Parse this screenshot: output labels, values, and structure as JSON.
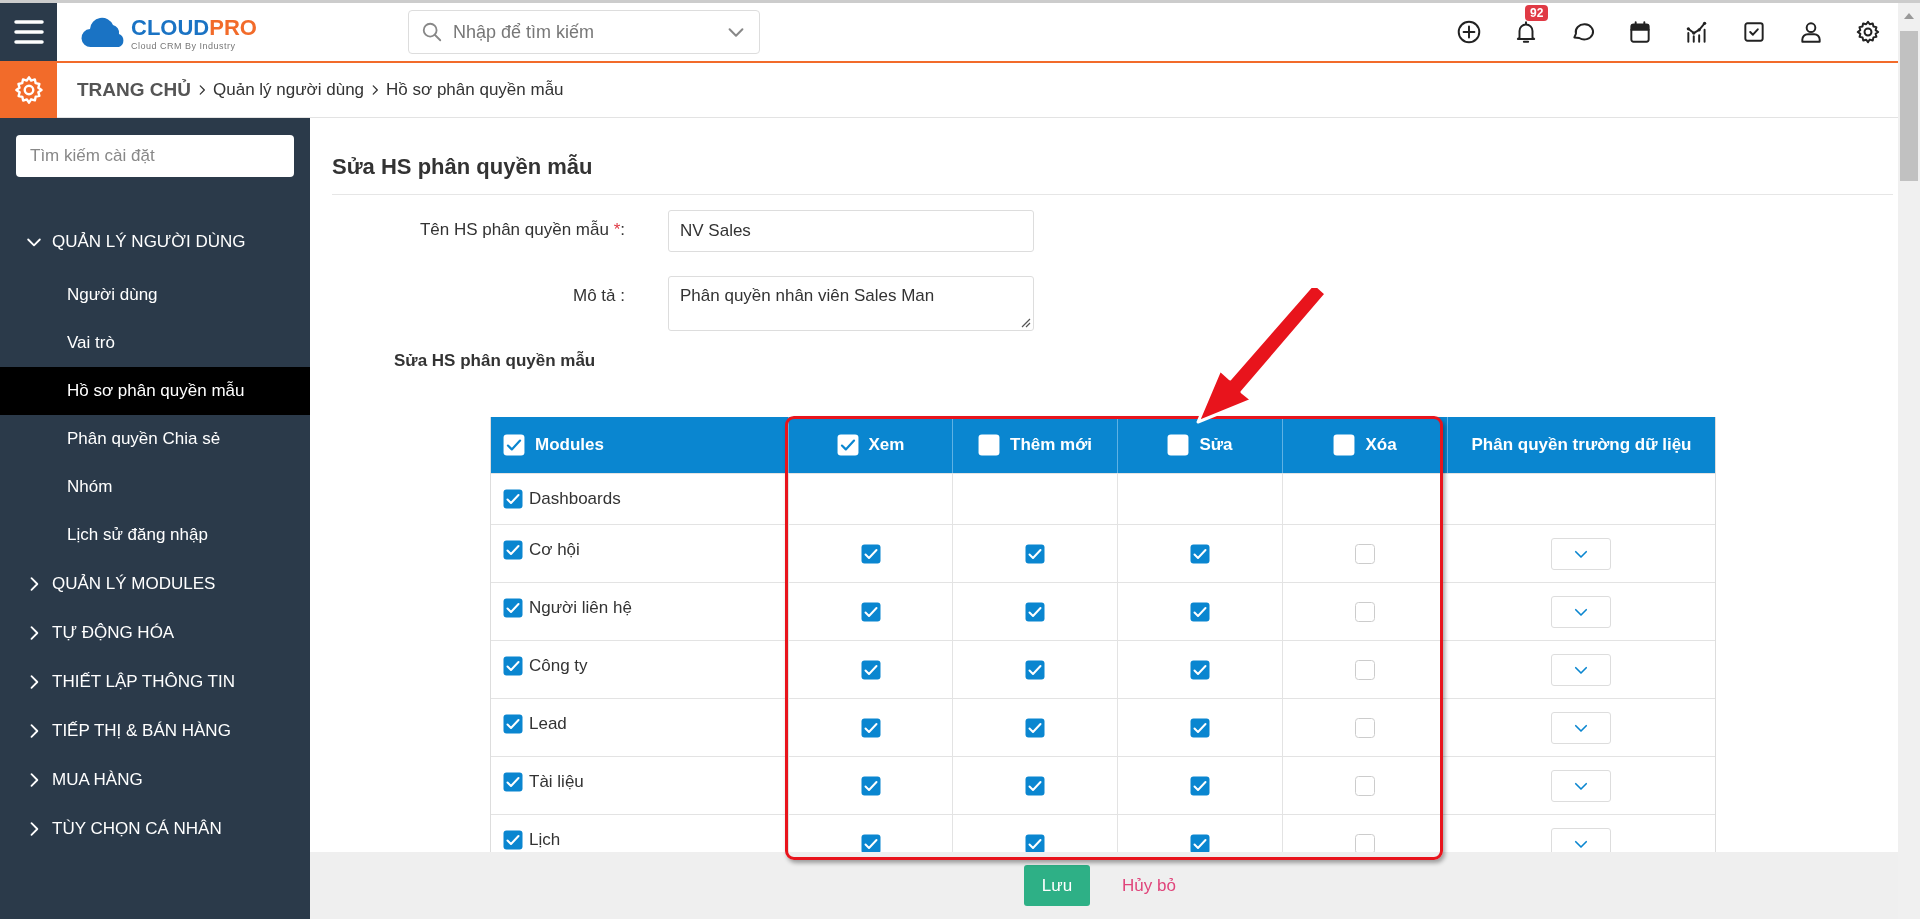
{
  "header": {
    "logo": {
      "part_1": "CLOUD",
      "part_2": "PRO",
      "tagline": "Cloud CRM By Industry"
    },
    "search": {
      "placeholder": "Nhập để tìm kiếm"
    },
    "notification_badge": "92"
  },
  "breadcrumb": [
    "TRANG CHỦ",
    "Quản lý người dùng",
    "Hồ sơ phân quyền mẫu"
  ],
  "sidebar": {
    "search": {
      "placeholder": "Tìm kiếm cài đặt"
    },
    "groups": [
      {
        "label": "QUẢN LÝ NGƯỜI DÙNG",
        "expanded": true,
        "children": [
          {
            "label": "Người dùng",
            "selected": false
          },
          {
            "label": "Vai trò",
            "selected": false
          },
          {
            "label": "Hồ sơ phân quyền mẫu",
            "selected": true
          },
          {
            "label": "Phân quyền Chia sẻ",
            "selected": false
          },
          {
            "label": "Nhóm",
            "selected": false
          },
          {
            "label": "Lịch sử đăng nhập",
            "selected": false
          }
        ]
      },
      {
        "label": "QUẢN LÝ MODULES",
        "expanded": false
      },
      {
        "label": "TỰ ĐỘNG HÓA",
        "expanded": false
      },
      {
        "label": "THIẾT LẬP THÔNG TIN",
        "expanded": false
      },
      {
        "label": "TIẾP THỊ & BÁN HÀNG",
        "expanded": false
      },
      {
        "label": "MUA HÀNG",
        "expanded": false
      },
      {
        "label": "TÙY CHỌN CÁ NHÂN",
        "expanded": false
      }
    ]
  },
  "form": {
    "title": "Sửa HS phân quyền mẫu",
    "fields": [
      {
        "kind": "input",
        "label": "Tên HS phân quyền mẫu",
        "required_mark": "*",
        "label_suffix": ":",
        "value": "NV Sales"
      },
      {
        "kind": "textarea",
        "label": "Mô tả :",
        "value": "Phân quyền nhân viên Sales Man"
      }
    ],
    "section_title": "Sửa HS phân quyền mẫu"
  },
  "table": {
    "columns": [
      {
        "label": "Modules",
        "checked": true
      },
      {
        "label": "Xem",
        "checked": true
      },
      {
        "label": "Thêm mới",
        "checked": false
      },
      {
        "label": "Sửa",
        "checked": false
      },
      {
        "label": "Xóa",
        "checked": false
      },
      {
        "label": "Phân quyền trường dữ liệu"
      }
    ],
    "rows": [
      {
        "kind": "summary",
        "module": "Dashboards",
        "checked": true
      },
      {
        "kind": "module",
        "module": "Cơ hội",
        "checked": true,
        "view": true,
        "create": true,
        "edit": true,
        "delete": false
      },
      {
        "kind": "module",
        "module": "Người liên hệ",
        "checked": true,
        "view": true,
        "create": true,
        "edit": true,
        "delete": false
      },
      {
        "kind": "module",
        "module": "Công ty",
        "checked": true,
        "view": true,
        "create": true,
        "edit": true,
        "delete": false
      },
      {
        "kind": "module",
        "module": "Lead",
        "checked": true,
        "view": true,
        "create": true,
        "edit": true,
        "delete": false
      },
      {
        "kind": "module",
        "module": "Tài liệu",
        "checked": true,
        "view": true,
        "create": true,
        "edit": true,
        "delete": false
      },
      {
        "kind": "module",
        "module": "Lịch",
        "checked": true,
        "view": true,
        "create": true,
        "edit": true,
        "delete": false
      }
    ]
  },
  "footer": {
    "buttons": [
      {
        "kind": "primary",
        "label": "Lưu"
      },
      {
        "kind": "link",
        "label": "Hủy bỏ"
      }
    ]
  }
}
